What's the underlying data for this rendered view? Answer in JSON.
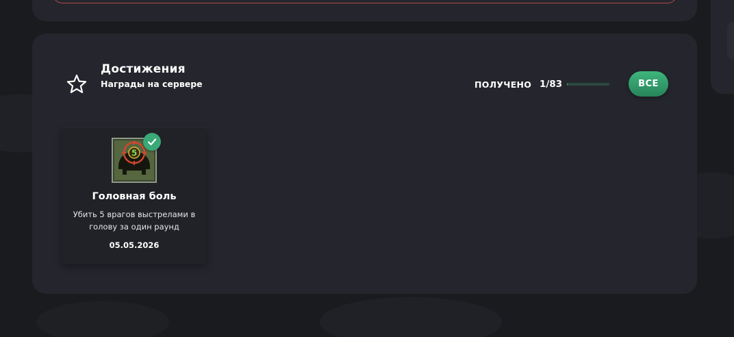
{
  "achievements": {
    "title": "Достижения",
    "subtitle": "Награды на сервере",
    "received_label": "ПОЛУЧЕНО",
    "received_count": "1/83",
    "progress": 0.012,
    "all_button_label": "ВСЕ",
    "cards": [
      {
        "title": "Головная боль",
        "description": "Убить 5 врагов выстрелами в голову за один раунд",
        "date": "05.05.2026",
        "icon": "helmet-crosshair-badge-icon",
        "icon_number": "5",
        "unlocked": true
      }
    ]
  },
  "colors": {
    "panel": "#25262d",
    "accent_green": "#3aa877",
    "input_border_red": "#b8484b"
  }
}
